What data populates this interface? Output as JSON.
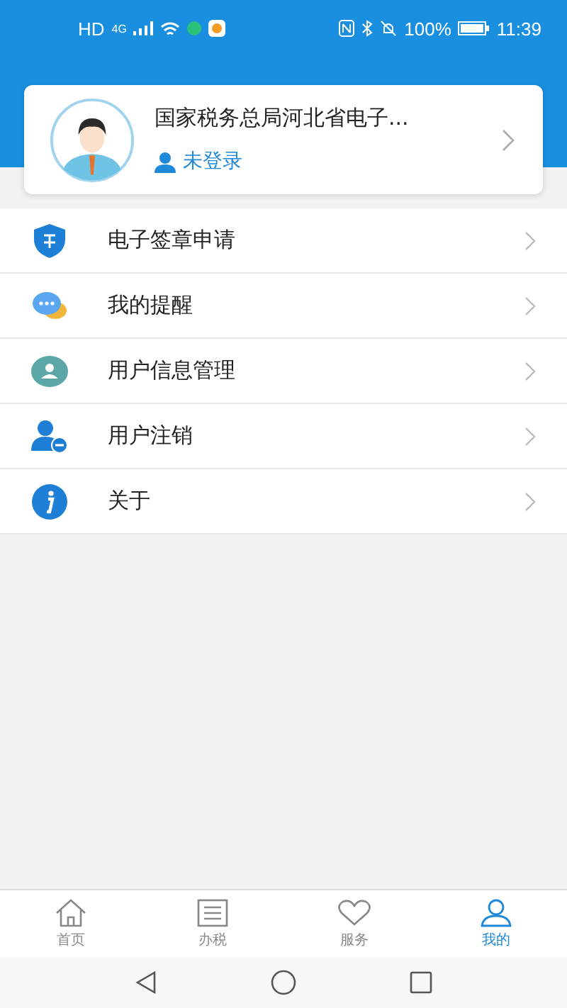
{
  "status_bar": {
    "left": [
      "HD",
      "4G"
    ],
    "battery": "100%",
    "time": "11:39"
  },
  "profile": {
    "name": "国家税务总局河北省电子...",
    "login_status": "未登录"
  },
  "menu": [
    {
      "kind": "seal",
      "label": "电子签章申请"
    },
    {
      "kind": "reminder",
      "label": "我的提醒"
    },
    {
      "kind": "user-info",
      "label": "用户信息管理"
    },
    {
      "kind": "user-remove",
      "label": "用户注销"
    },
    {
      "kind": "about",
      "label": "关于"
    }
  ],
  "tab_bar": [
    {
      "kind": "home",
      "label": "首页",
      "selected": false
    },
    {
      "kind": "list",
      "label": "办税",
      "selected": false
    },
    {
      "kind": "heart",
      "label": "服务",
      "selected": false
    },
    {
      "kind": "person",
      "label": "我的",
      "selected": true
    }
  ]
}
